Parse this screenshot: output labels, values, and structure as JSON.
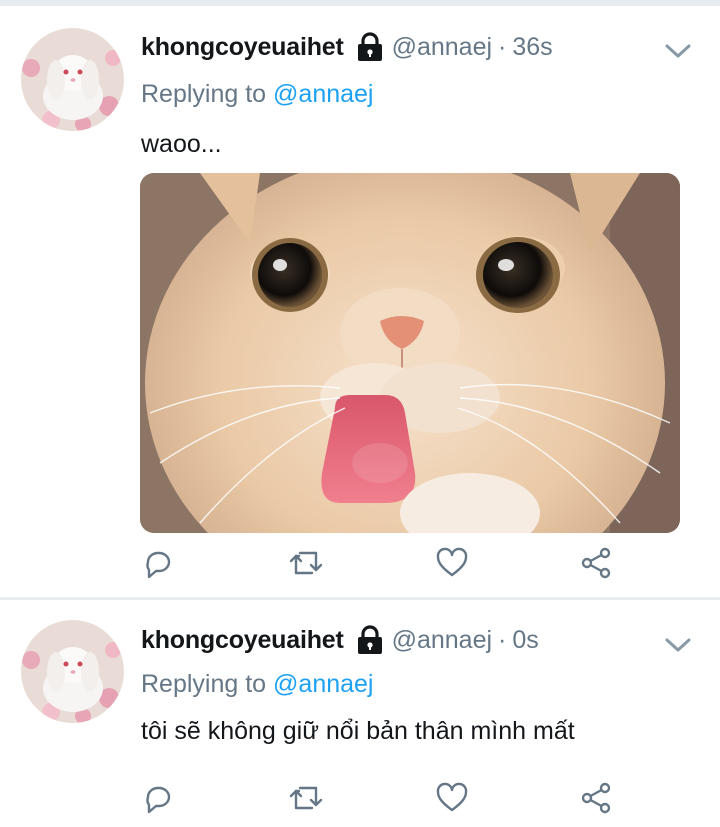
{
  "colors": {
    "text": "#14171a",
    "secondary": "#657786",
    "link": "#1da1f2",
    "divider": "#e6ecf0",
    "background": "#ffffff"
  },
  "tweets": [
    {
      "display_name": "khongcoyeuaihet",
      "protected_icon": "lock-icon",
      "handle": "@annaej",
      "separator": "·",
      "time": "36s",
      "replying_prefix": "Replying to",
      "replying_to": "@annaej",
      "text": "waoo...",
      "has_media": true,
      "actions": [
        "reply-icon",
        "retweet-icon",
        "like-icon",
        "share-icon"
      ]
    },
    {
      "display_name": "khongcoyeuaihet",
      "protected_icon": "lock-icon",
      "handle": "@annaej",
      "separator": "·",
      "time": "0s",
      "replying_prefix": "Replying to",
      "replying_to": "@annaej",
      "text": "tôi sẽ không giữ nổi bản thân mình mất",
      "has_media": false,
      "actions": [
        "reply-icon",
        "retweet-icon",
        "like-icon",
        "share-icon"
      ]
    }
  ]
}
